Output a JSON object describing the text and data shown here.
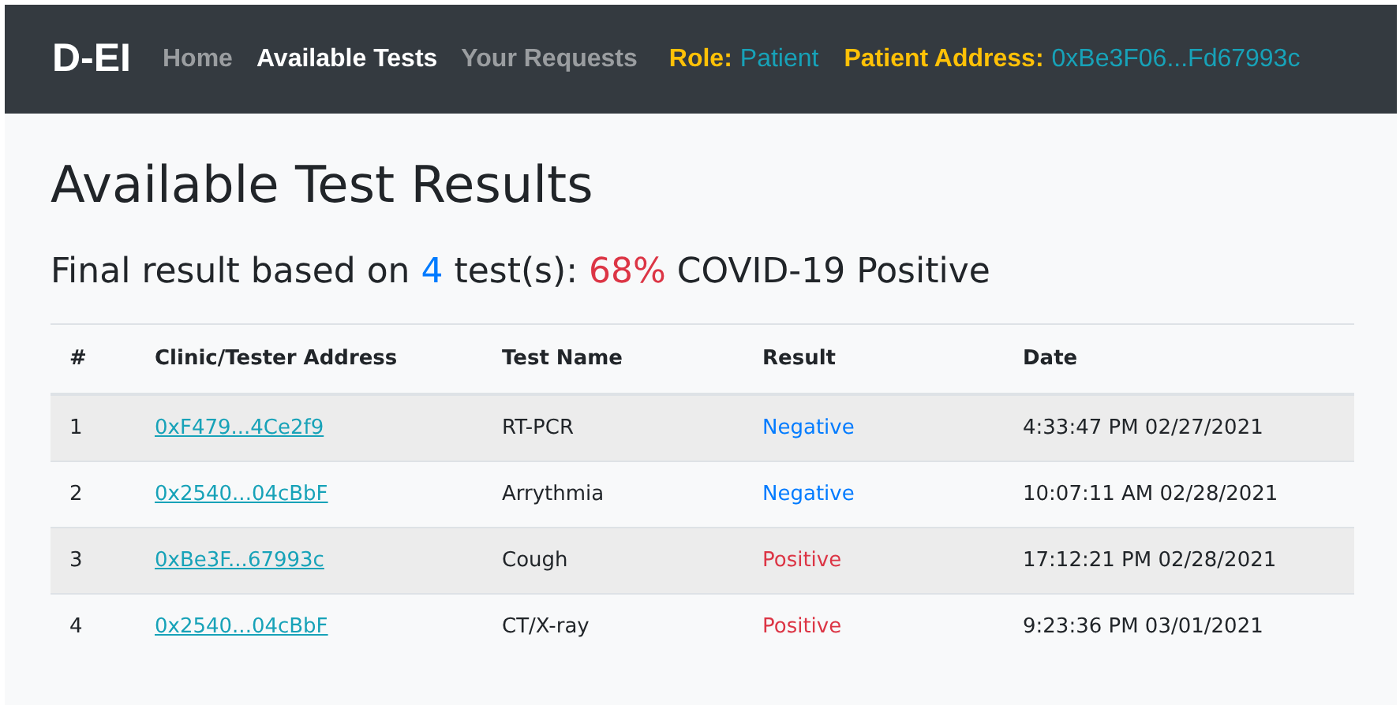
{
  "navbar": {
    "brand": "D-EI",
    "links": [
      {
        "label": "Home",
        "selected": false
      },
      {
        "label": "Available Tests",
        "selected": true
      },
      {
        "label": "Your Requests",
        "selected": false
      }
    ],
    "info": [
      {
        "label": "Role:",
        "value": "Patient"
      },
      {
        "label": "Patient Address:",
        "value": "0xBe3F06...Fd67993c"
      }
    ]
  },
  "heading": "Available Test Results",
  "summary": {
    "prefix": "Final result based on",
    "count": "4",
    "middle": "test(s):",
    "percent": "68%",
    "suffix": "COVID-19 Positive"
  },
  "table": {
    "columns": [
      "#",
      "Clinic/Tester Address",
      "Test Name",
      "Result",
      "Date"
    ],
    "rows": [
      {
        "index": "1",
        "address": "0xF479...4Ce2f9",
        "test": "RT-PCR",
        "result": {
          "label": "Negative",
          "kind": "negative"
        },
        "date": "4:33:47 PM 02/27/2021"
      },
      {
        "index": "2",
        "address": "0x2540...04cBbF",
        "test": "Arrythmia",
        "result": {
          "label": "Negative",
          "kind": "negative"
        },
        "date": "10:07:11 AM 02/28/2021"
      },
      {
        "index": "3",
        "address": "0xBe3F...67993c",
        "test": "Cough",
        "result": {
          "label": "Positive",
          "kind": "positive"
        },
        "date": "17:12:21 PM 02/28/2021"
      },
      {
        "index": "4",
        "address": "0x2540...04cBbF",
        "test": "CT/X-ray",
        "result": {
          "label": "Positive",
          "kind": "positive"
        },
        "date": "9:23:36 PM 03/01/2021"
      }
    ]
  }
}
